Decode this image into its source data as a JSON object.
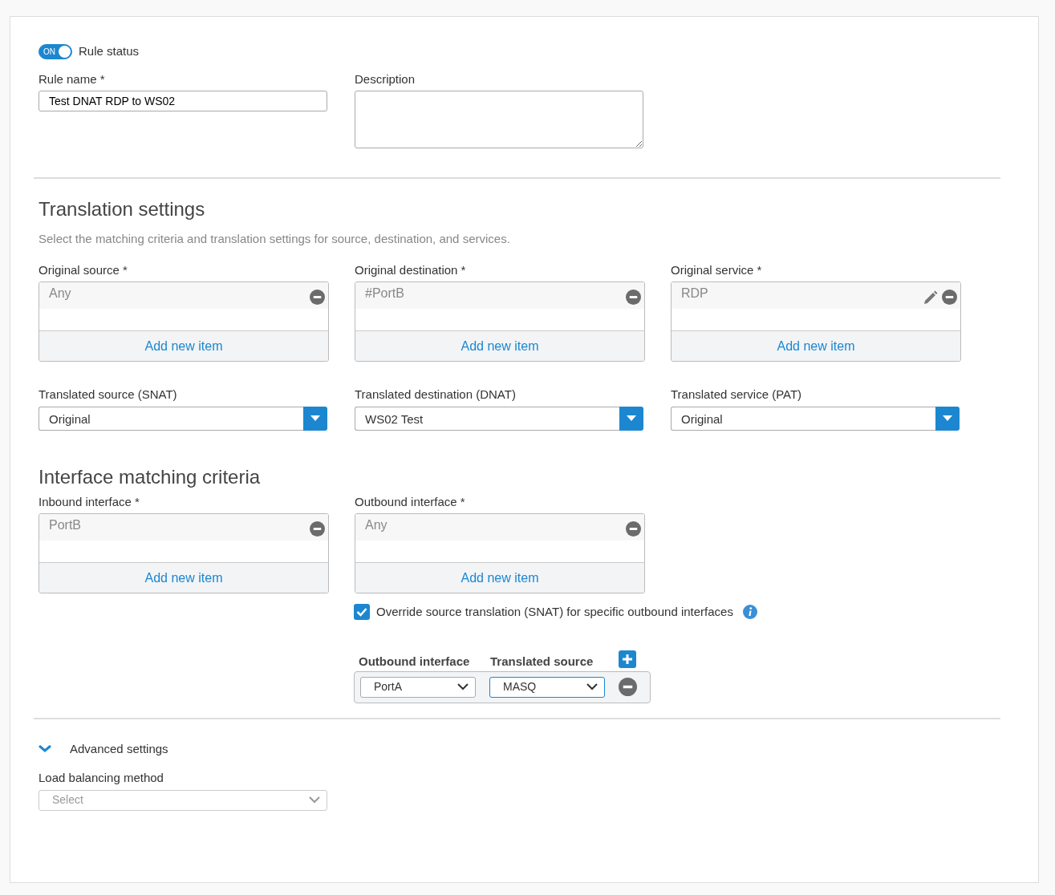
{
  "rule_status": {
    "label": "Rule status",
    "toggle_text": "ON",
    "on": true
  },
  "rule_name": {
    "label": "Rule name *",
    "value": "Test DNAT RDP to WS02"
  },
  "description": {
    "label": "Description"
  },
  "translation": {
    "title": "Translation settings",
    "subtitle": "Select the matching criteria and translation settings for source, destination, and services.",
    "original": [
      {
        "label": "Original source *",
        "items": [
          {
            "text": "Any",
            "editable": false
          }
        ],
        "add_label": "Add new item"
      },
      {
        "label": "Original destination *",
        "items": [
          {
            "text": "#PortB",
            "editable": false
          }
        ],
        "add_label": "Add new item"
      },
      {
        "label": "Original service *",
        "items": [
          {
            "text": "RDP",
            "editable": true
          }
        ],
        "add_label": "Add new item"
      }
    ],
    "translated": [
      {
        "label": "Translated source (SNAT)",
        "value": "Original"
      },
      {
        "label": "Translated destination (DNAT)",
        "value": "WS02 Test"
      },
      {
        "label": "Translated service (PAT)",
        "value": "Original"
      }
    ]
  },
  "interface": {
    "title": "Interface matching criteria",
    "lists": [
      {
        "label": "Inbound interface *",
        "items": [
          {
            "text": "PortB",
            "editable": false
          }
        ],
        "add_label": "Add new item"
      },
      {
        "label": "Outbound interface *",
        "items": [
          {
            "text": "Any",
            "editable": false
          }
        ],
        "add_label": "Add new item"
      }
    ],
    "override": {
      "label": "Override source translation (SNAT) for specific outbound interfaces",
      "checked": true
    },
    "snat_table": {
      "columns": [
        "Outbound interface",
        "Translated source"
      ],
      "rows": [
        {
          "interface": "PortA",
          "source": "MASQ",
          "focused": true
        }
      ]
    }
  },
  "advanced": {
    "label": "Advanced settings",
    "expanded": true
  },
  "load_balancing": {
    "label": "Load balancing method",
    "placeholder": "Select"
  }
}
